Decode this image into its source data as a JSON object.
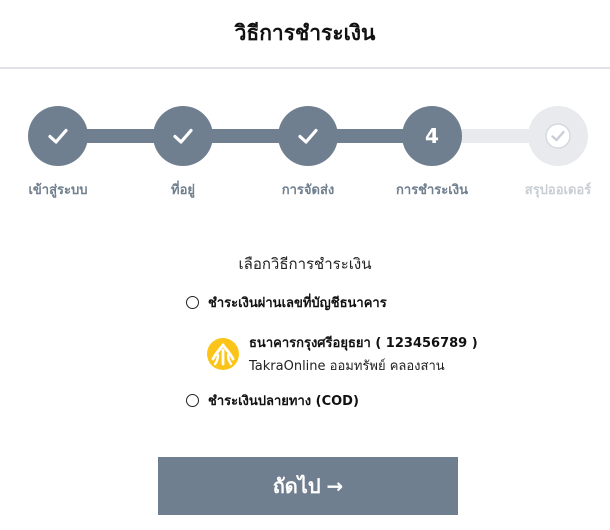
{
  "header": {
    "title": "วิธีการชำระเงิน"
  },
  "steps": [
    {
      "label": "เข้าสู่ระบบ",
      "status": "done",
      "icon": "check-icon"
    },
    {
      "label": "ที่อยู่",
      "status": "done",
      "icon": "check-icon"
    },
    {
      "label": "การจัดส่ง",
      "status": "done",
      "icon": "check-icon"
    },
    {
      "label": "การชำระเงิน",
      "status": "current",
      "number": "4"
    },
    {
      "label": "สรุปออเดอร์",
      "status": "pending",
      "icon": "check-circle-icon"
    }
  ],
  "payment": {
    "title": "เลือกวิธีการชำระเงิน",
    "options": [
      {
        "label": "ชำระเงินผ่านเลขที่บัญชีธนาคาร",
        "selected": false
      },
      {
        "label": "ชำระเงินปลายทาง (COD)",
        "selected": false
      }
    ],
    "bank": {
      "name": "ธนาคารกรุงศรีอยุธยา ( 123456789 )",
      "account": "TakraOnline ออมทรัพย์ คลองสาน",
      "logo_color": "#fcc419"
    }
  },
  "actions": {
    "next_label": "ถัดไป",
    "next_icon": "arrow-right-icon"
  },
  "colors": {
    "primary": "#707f8f",
    "pending": "#e8eaed",
    "pending_text": "#c9ced4"
  }
}
